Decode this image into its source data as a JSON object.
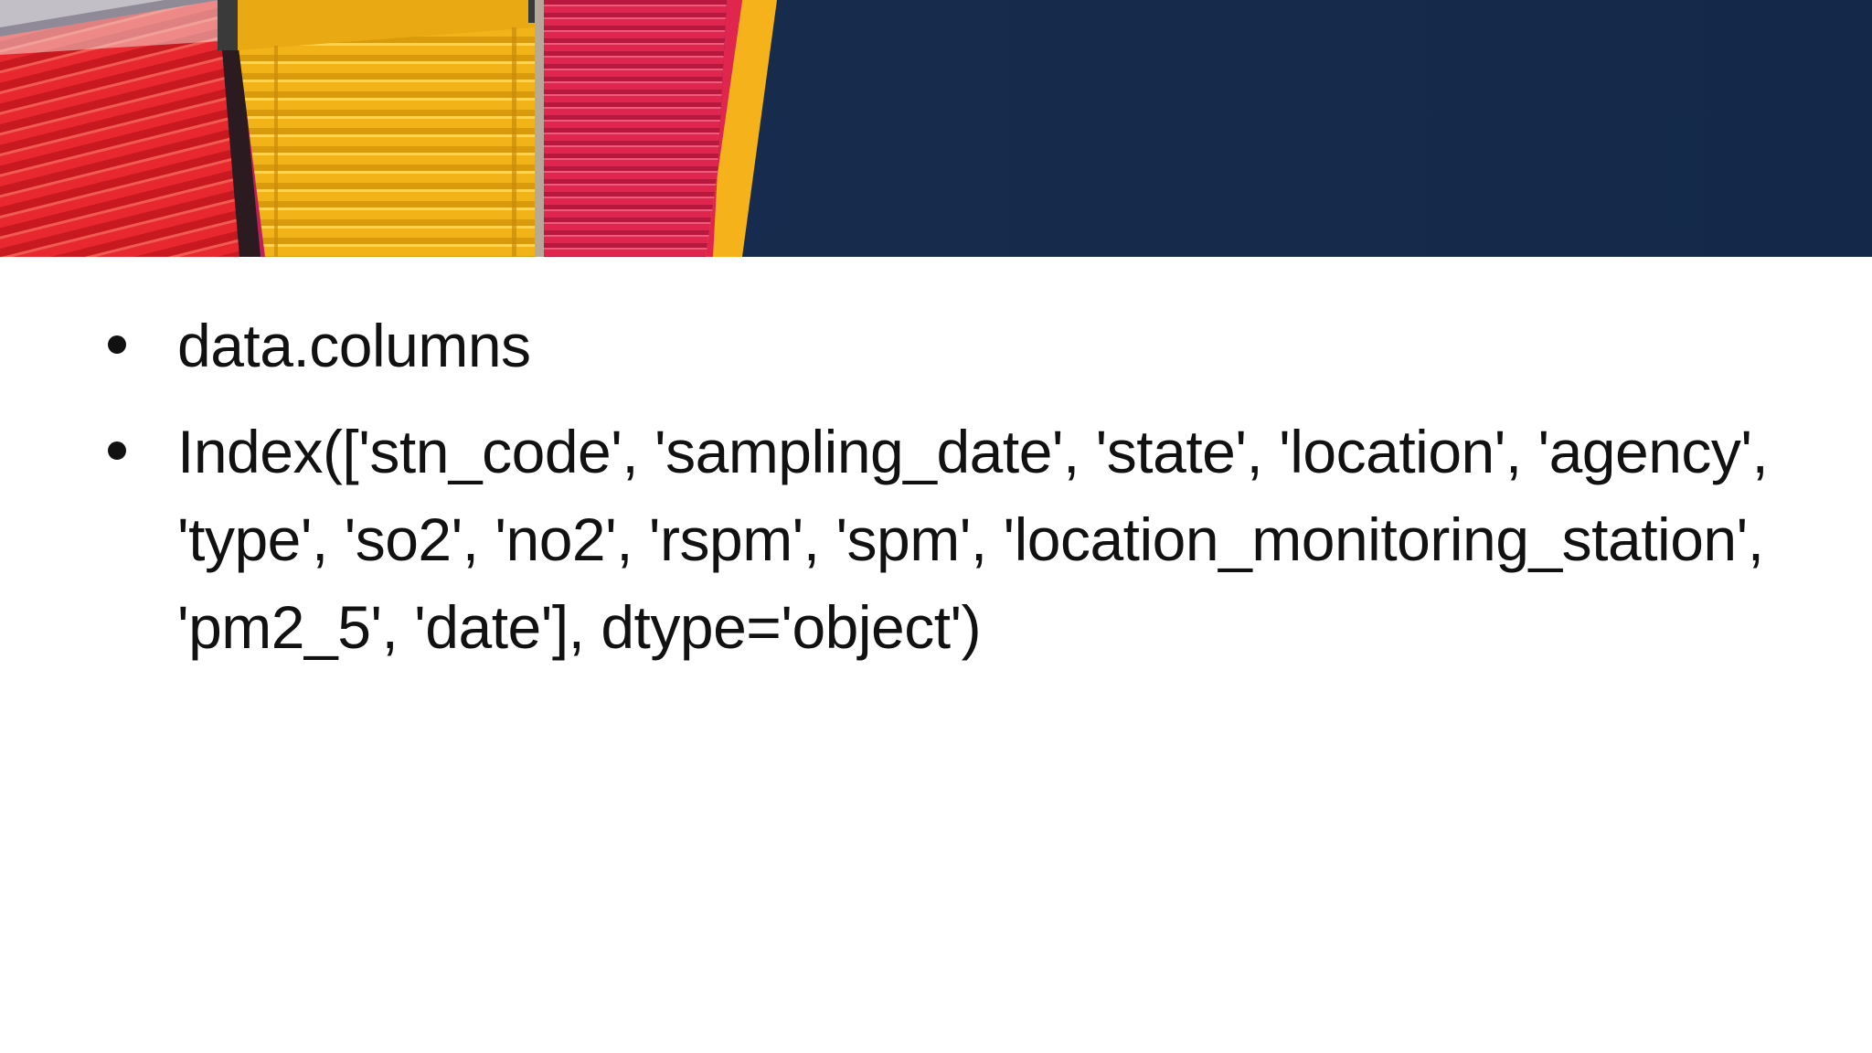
{
  "slide": {
    "bullets": [
      {
        "text": "data.columns"
      },
      {
        "text": "Index(['stn_code', 'sampling_date', 'state', 'location', 'agency', 'type', 'so2', 'no2', 'rspm', 'spm', 'location_monitoring_station', 'pm2_5', 'date'], dtype='object')"
      }
    ]
  },
  "colors": {
    "banner_navy": "#172b4d",
    "container_red": "#e8282e",
    "container_yellow": "#f2b319",
    "container_pink": "#e0254f",
    "accent_stripe": "#f5b21a",
    "text": "#111111"
  },
  "icons": {
    "bullet": "bullet-dot-icon"
  }
}
